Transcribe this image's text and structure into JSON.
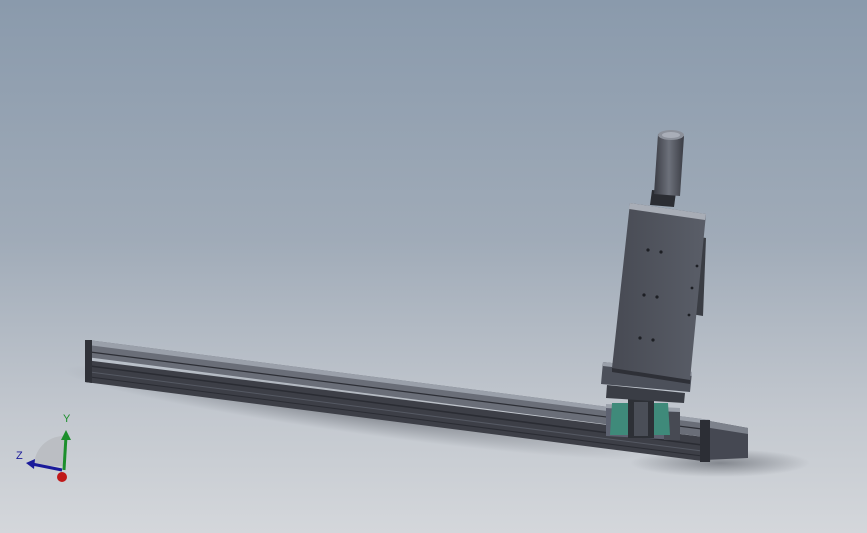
{
  "viewport": {
    "background_top": "#8a9aac",
    "background_bottom": "#d4d7db"
  },
  "model": {
    "components": [
      "linear-rail",
      "carriage",
      "vertical-actuator",
      "motor",
      "coupling"
    ],
    "colors": {
      "metal_dark": "#3d3f47",
      "metal_mid": "#5c606b",
      "metal_light": "#8e939d",
      "coupling_teal": "#3f8a7a"
    }
  },
  "triad": {
    "y_label": "Y",
    "z_label": "Z",
    "y_color": "#1c8f2c",
    "z_color": "#1a1a9a",
    "x_color": "#c01818"
  }
}
